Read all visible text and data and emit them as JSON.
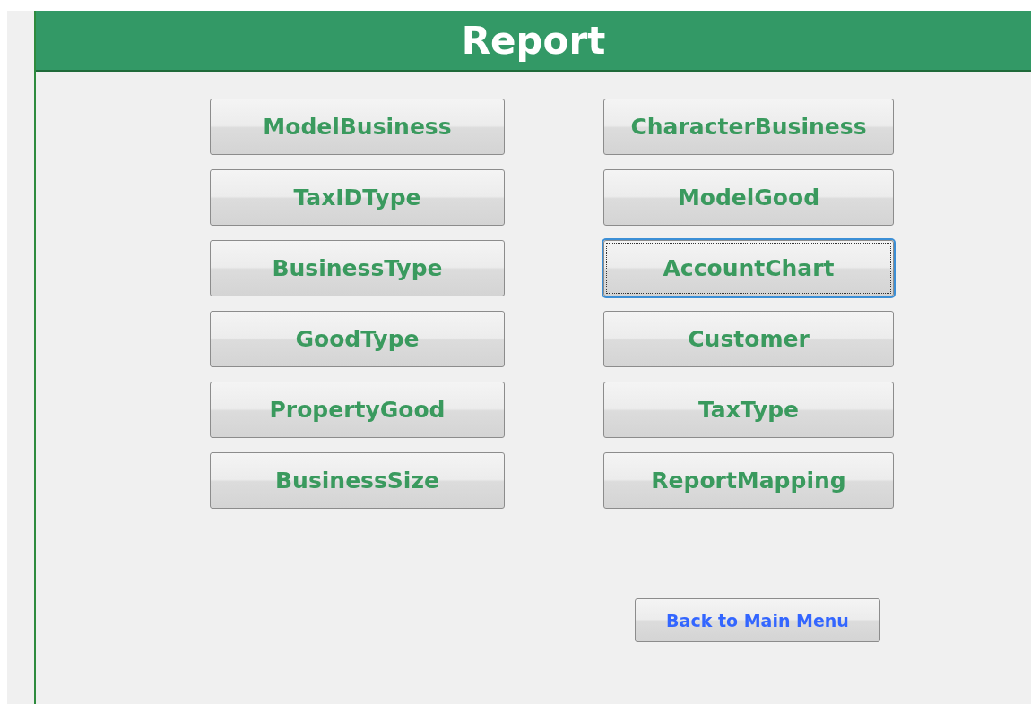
{
  "header": {
    "title": "Report"
  },
  "left_buttons": [
    {
      "label": "ModelBusiness",
      "focused": false
    },
    {
      "label": "TaxIDType",
      "focused": false
    },
    {
      "label": "BusinessType",
      "focused": false
    },
    {
      "label": "GoodType",
      "focused": false
    },
    {
      "label": "PropertyGood",
      "focused": false
    },
    {
      "label": "BusinessSize",
      "focused": false
    }
  ],
  "right_buttons": [
    {
      "label": "CharacterBusiness",
      "focused": false
    },
    {
      "label": "ModelGood",
      "focused": false
    },
    {
      "label": "AccountChart",
      "focused": true
    },
    {
      "label": "Customer",
      "focused": false
    },
    {
      "label": "TaxType",
      "focused": false
    },
    {
      "label": "ReportMapping",
      "focused": false
    }
  ],
  "back_button": {
    "label": "Back to Main Menu"
  }
}
